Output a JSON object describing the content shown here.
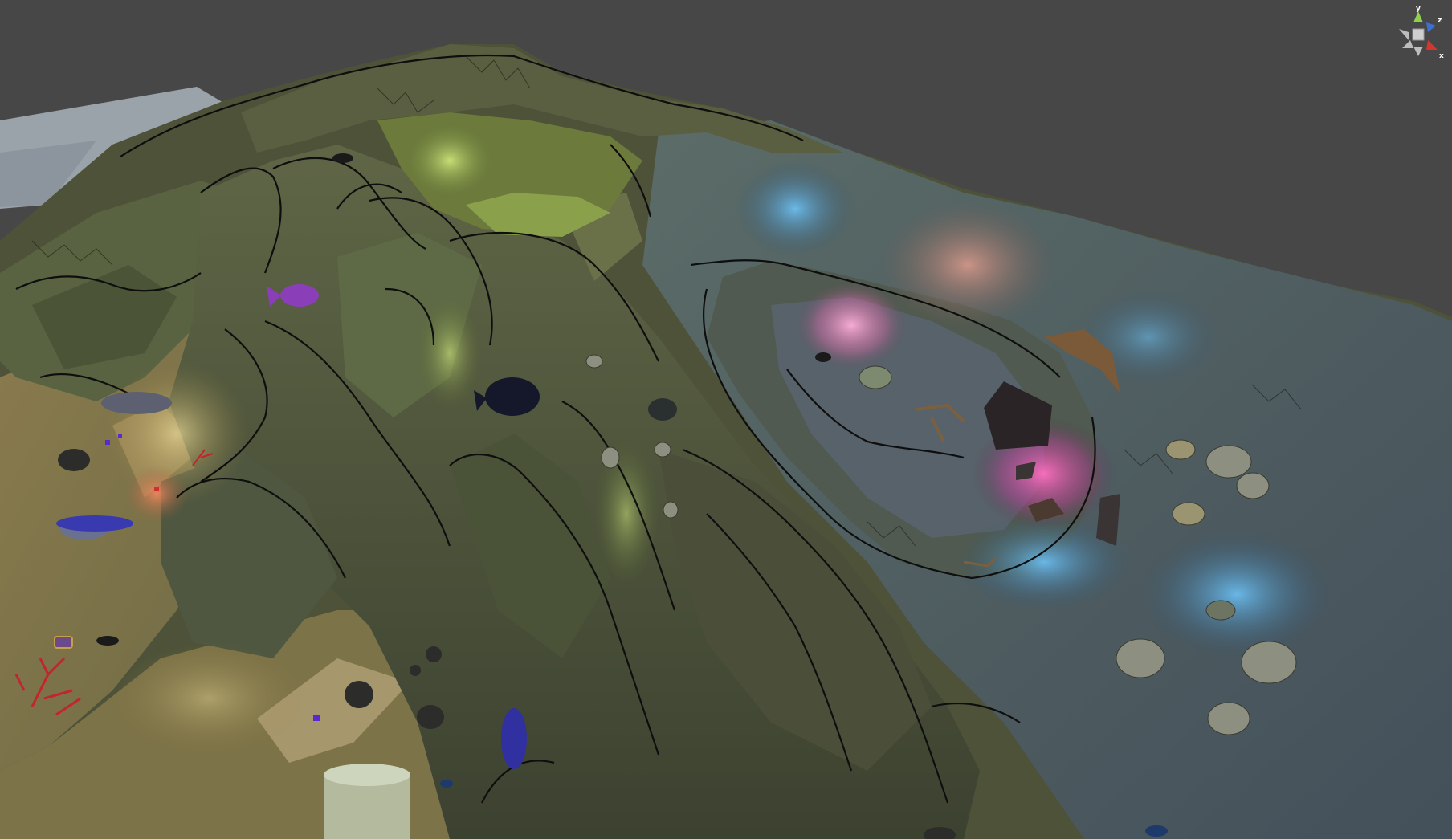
{
  "scene_view": {
    "background_color": "#474747",
    "gizmo": {
      "labels": {
        "y": "y",
        "z": "z",
        "x": "x"
      },
      "colors": {
        "y": "#8fd14f",
        "z": "#3b6fd6",
        "x": "#d9342b",
        "center": "#cfcfcf"
      }
    }
  }
}
